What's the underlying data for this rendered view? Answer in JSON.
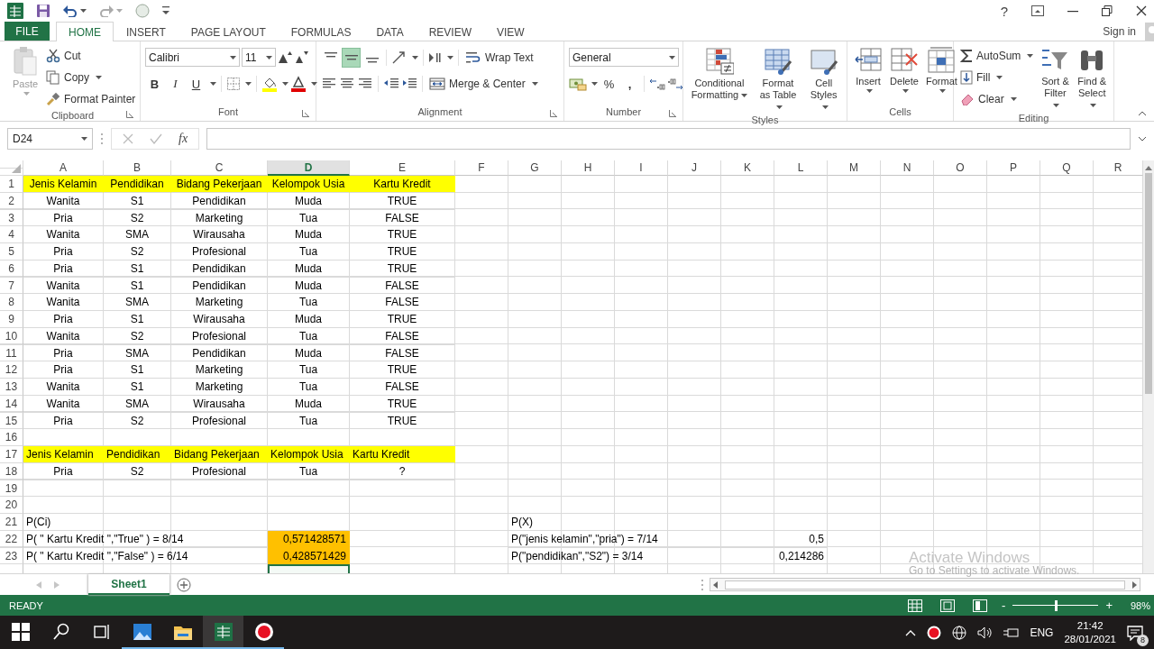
{
  "window": {
    "help": "?"
  },
  "menu_tabs": [
    {
      "label": "FILE",
      "kind": "file",
      "selected": false
    },
    {
      "label": "HOME",
      "kind": "tab",
      "selected": true
    },
    {
      "label": "INSERT",
      "kind": "tab",
      "selected": false
    },
    {
      "label": "PAGE LAYOUT",
      "kind": "tab",
      "selected": false
    },
    {
      "label": "FORMULAS",
      "kind": "tab",
      "selected": false
    },
    {
      "label": "DATA",
      "kind": "tab",
      "selected": false
    },
    {
      "label": "REVIEW",
      "kind": "tab",
      "selected": false
    },
    {
      "label": "VIEW",
      "kind": "tab",
      "selected": false
    }
  ],
  "account": {
    "sign_in": "Sign in"
  },
  "ribbon": {
    "clipboard": {
      "title": "Clipboard",
      "paste": {
        "label": "Paste",
        "disabled": true
      },
      "cut": "Cut",
      "copy": "Copy",
      "format_painter": "Format Painter"
    },
    "font": {
      "title": "Font",
      "name": "Calibri",
      "size": "11",
      "bold": "B",
      "italic": "I",
      "underline": "U"
    },
    "alignment": {
      "title": "Alignment",
      "vertical": [
        {
          "selected": false
        },
        {
          "selected": true
        },
        {
          "selected": false
        }
      ],
      "wrap_text": "Wrap Text",
      "merge_center": "Merge & Center"
    },
    "number": {
      "title": "Number",
      "format": "General",
      "percent": "%",
      "comma": ","
    },
    "styles": {
      "title": "Styles",
      "buttons": [
        "Conditional Formatting",
        "Format as Table",
        "Cell Styles"
      ]
    },
    "cells": {
      "title": "Cells",
      "buttons": [
        "Insert",
        "Delete",
        "Format"
      ]
    },
    "editing": {
      "title": "Editing",
      "autosum": "AutoSum",
      "fill": "Fill",
      "clear": "Clear",
      "sort_filter": "Sort & Filter",
      "find_select": "Find & Select"
    }
  },
  "formula_bar": {
    "name_box": "D24",
    "function_label": "fx"
  },
  "sheet": {
    "columns": [
      {
        "label": "A",
        "selected": false
      },
      {
        "label": "B",
        "selected": false
      },
      {
        "label": "C",
        "selected": false
      },
      {
        "label": "D",
        "selected": true
      },
      {
        "label": "E",
        "selected": false
      },
      {
        "label": "F",
        "selected": false
      },
      {
        "label": "G",
        "selected": false
      },
      {
        "label": "H",
        "selected": false
      },
      {
        "label": "I",
        "selected": false
      },
      {
        "label": "J",
        "selected": false
      },
      {
        "label": "K",
        "selected": false
      },
      {
        "label": "L",
        "selected": false
      },
      {
        "label": "M",
        "selected": false
      },
      {
        "label": "N",
        "selected": false
      },
      {
        "label": "O",
        "selected": false
      },
      {
        "label": "P",
        "selected": false
      },
      {
        "label": "Q",
        "selected": false
      },
      {
        "label": "R",
        "selected": false
      }
    ],
    "rows": [
      {
        "number": "1",
        "cells": [
          {
            "kind": "head",
            "text": "Jenis Kelamin"
          },
          {
            "kind": "head",
            "text": "Pendidikan"
          },
          {
            "kind": "head",
            "text": "Bidang Pekerjaan"
          },
          {
            "kind": "head",
            "text": "Kelompok Usia"
          },
          {
            "kind": "head",
            "text": "Kartu Kredit"
          }
        ]
      },
      {
        "number": "2",
        "cells": [
          {
            "kind": "text",
            "text": "Wanita"
          },
          {
            "kind": "text",
            "text": "S1"
          },
          {
            "kind": "text",
            "text": "Pendidikan"
          },
          {
            "kind": "text",
            "text": "Muda"
          },
          {
            "kind": "text",
            "text": "TRUE"
          }
        ]
      },
      {
        "number": "3",
        "cells": [
          {
            "kind": "text",
            "text": "Pria"
          },
          {
            "kind": "text",
            "text": "S2"
          },
          {
            "kind": "text",
            "text": "Marketing"
          },
          {
            "kind": "text",
            "text": "Tua"
          },
          {
            "kind": "text",
            "text": "FALSE"
          }
        ]
      },
      {
        "number": "4",
        "cells": [
          {
            "kind": "text",
            "text": "Wanita"
          },
          {
            "kind": "text",
            "text": "SMA"
          },
          {
            "kind": "text",
            "text": "Wirausaha"
          },
          {
            "kind": "text",
            "text": "Muda"
          },
          {
            "kind": "text",
            "text": "TRUE"
          }
        ]
      },
      {
        "number": "5",
        "cells": [
          {
            "kind": "text",
            "text": "Pria"
          },
          {
            "kind": "text",
            "text": "S2"
          },
          {
            "kind": "text",
            "text": "Profesional"
          },
          {
            "kind": "text",
            "text": "Tua"
          },
          {
            "kind": "text",
            "text": "TRUE"
          }
        ]
      },
      {
        "number": "6",
        "cells": [
          {
            "kind": "text",
            "text": "Pria"
          },
          {
            "kind": "text",
            "text": "S1"
          },
          {
            "kind": "text",
            "text": "Pendidikan"
          },
          {
            "kind": "text",
            "text": "Muda"
          },
          {
            "kind": "text",
            "text": "TRUE"
          }
        ]
      },
      {
        "number": "7",
        "cells": [
          {
            "kind": "text",
            "text": "Wanita"
          },
          {
            "kind": "text",
            "text": "S1"
          },
          {
            "kind": "text",
            "text": "Pendidikan"
          },
          {
            "kind": "text",
            "text": "Muda"
          },
          {
            "kind": "text",
            "text": "FALSE"
          }
        ]
      },
      {
        "number": "8",
        "cells": [
          {
            "kind": "text",
            "text": "Wanita"
          },
          {
            "kind": "text",
            "text": "SMA"
          },
          {
            "kind": "text",
            "text": "Marketing"
          },
          {
            "kind": "text",
            "text": "Tua"
          },
          {
            "kind": "text",
            "text": "FALSE"
          }
        ]
      },
      {
        "number": "9",
        "cells": [
          {
            "kind": "text",
            "text": "Pria"
          },
          {
            "kind": "text",
            "text": "S1"
          },
          {
            "kind": "text",
            "text": "Wirausaha"
          },
          {
            "kind": "text",
            "text": "Muda"
          },
          {
            "kind": "text",
            "text": "TRUE"
          }
        ]
      },
      {
        "number": "10",
        "cells": [
          {
            "kind": "text",
            "text": "Wanita"
          },
          {
            "kind": "text",
            "text": "S2"
          },
          {
            "kind": "text",
            "text": "Profesional"
          },
          {
            "kind": "text",
            "text": "Tua"
          },
          {
            "kind": "text",
            "text": "FALSE"
          }
        ]
      },
      {
        "number": "11",
        "cells": [
          {
            "kind": "text",
            "text": "Pria"
          },
          {
            "kind": "text",
            "text": "SMA"
          },
          {
            "kind": "text",
            "text": "Pendidikan"
          },
          {
            "kind": "text",
            "text": "Muda"
          },
          {
            "kind": "text",
            "text": "FALSE"
          }
        ]
      },
      {
        "number": "12",
        "cells": [
          {
            "kind": "text",
            "text": "Pria"
          },
          {
            "kind": "text",
            "text": "S1"
          },
          {
            "kind": "text",
            "text": "Marketing"
          },
          {
            "kind": "text",
            "text": "Tua"
          },
          {
            "kind": "text",
            "text": "TRUE"
          }
        ]
      },
      {
        "number": "13",
        "cells": [
          {
            "kind": "text",
            "text": "Wanita"
          },
          {
            "kind": "text",
            "text": "S1"
          },
          {
            "kind": "text",
            "text": "Marketing"
          },
          {
            "kind": "text",
            "text": "Tua"
          },
          {
            "kind": "text",
            "text": "FALSE"
          }
        ]
      },
      {
        "number": "14",
        "cells": [
          {
            "kind": "text",
            "text": "Wanita"
          },
          {
            "kind": "text",
            "text": "SMA"
          },
          {
            "kind": "text",
            "text": "Wirausaha"
          },
          {
            "kind": "text",
            "text": "Muda"
          },
          {
            "kind": "text",
            "text": "TRUE"
          }
        ]
      },
      {
        "number": "15",
        "cells": [
          {
            "kind": "text",
            "text": "Pria"
          },
          {
            "kind": "text",
            "text": "S2"
          },
          {
            "kind": "text",
            "text": "Profesional"
          },
          {
            "kind": "text",
            "text": "Tua"
          },
          {
            "kind": "text",
            "text": "TRUE"
          }
        ]
      },
      {
        "number": "16"
      },
      {
        "number": "17",
        "cells": [
          {
            "kind": "head-left",
            "text": "Jenis Kelamin"
          },
          {
            "kind": "head-left",
            "text": "Pendidikan"
          },
          {
            "kind": "head-left",
            "text": "Bidang Pekerjaan"
          },
          {
            "kind": "head-left",
            "text": "Kelompok Usia"
          },
          {
            "kind": "head-left",
            "text": "Kartu Kredit"
          }
        ]
      },
      {
        "number": "18",
        "cells": [
          {
            "kind": "text",
            "text": "Pria"
          },
          {
            "kind": "text",
            "text": "S2"
          },
          {
            "kind": "text",
            "text": "Profesional"
          },
          {
            "kind": "text",
            "text": "Tua"
          },
          {
            "kind": "text",
            "text": "?"
          }
        ]
      },
      {
        "number": "19"
      },
      {
        "number": "20"
      },
      {
        "number": "21",
        "cells": [
          {
            "kind": "note",
            "text": "P(Ci)"
          },
          {
            "kind": "empty"
          },
          {
            "kind": "empty"
          },
          {
            "kind": "empty"
          },
          {
            "kind": "empty"
          },
          {
            "kind": "empty"
          },
          {
            "kind": "note",
            "text": "P(X)"
          }
        ]
      },
      {
        "number": "22",
        "cells": [
          {
            "kind": "note",
            "text": "P( \" Kartu Kredit \",\"True\" ) = 8/14"
          },
          {
            "kind": "covered"
          },
          {
            "kind": "covered"
          },
          {
            "kind": "highlight",
            "text": "0,571428571"
          },
          {
            "kind": "empty"
          },
          {
            "kind": "empty"
          },
          {
            "kind": "note",
            "text": "P(\"jenis kelamin\",\"pria\") = 7/14"
          },
          {
            "kind": "covered"
          },
          {
            "kind": "covered"
          },
          {
            "kind": "covered"
          },
          {
            "kind": "covered"
          },
          {
            "kind": "number",
            "text": "0,5"
          }
        ]
      },
      {
        "number": "23",
        "cells": [
          {
            "kind": "note",
            "text": "P( \" Kartu Kredit \",\"False\" ) = 6/14"
          },
          {
            "kind": "covered"
          },
          {
            "kind": "covered"
          },
          {
            "kind": "highlight",
            "text": "0,428571429"
          },
          {
            "kind": "empty"
          },
          {
            "kind": "empty"
          },
          {
            "kind": "note",
            "text": "P(\"pendidikan\",\"S2\") = 3/14"
          },
          {
            "kind": "covered"
          },
          {
            "kind": "covered"
          },
          {
            "kind": "empty"
          },
          {
            "kind": "empty"
          },
          {
            "kind": "number",
            "text": "0,214286"
          }
        ]
      },
      {
        "cells": [
          {
            "kind": "empty",
            "selected": false
          },
          {
            "kind": "empty",
            "selected": false
          },
          {
            "kind": "empty",
            "selected": false
          },
          {
            "kind": "empty",
            "selected": true
          },
          {
            "kind": "empty",
            "selected": false
          }
        ]
      }
    ]
  },
  "sheet_tabs": [
    {
      "label": "Sheet1",
      "selected": true
    }
  ],
  "status_bar": {
    "status": "READY",
    "zoom_out": "-",
    "zoom_in": "+",
    "zoom": {
      "level": 0.5
    },
    "zoom_label": "98%"
  },
  "taskbar": {
    "language": "ENG",
    "time": "21:42",
    "date": "28/01/2021",
    "notifications": "8"
  },
  "activation_notice": {
    "title": "Activate Windows",
    "message": "Go to Settings to activate Windows."
  }
}
